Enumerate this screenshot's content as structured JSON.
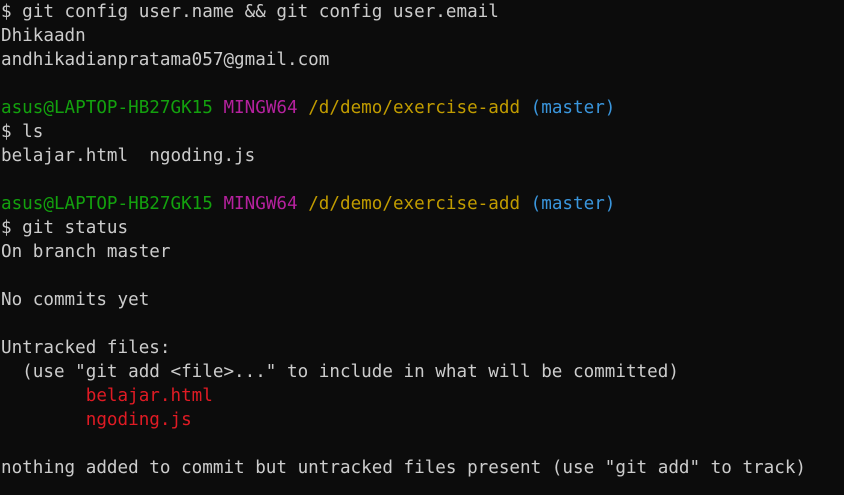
{
  "terminal": {
    "lines": [
      {
        "segments": [
          {
            "text": "$ git config user.name && git config user.email",
            "color": "white"
          }
        ]
      },
      {
        "segments": [
          {
            "text": "Dhikaadn",
            "color": "white"
          }
        ]
      },
      {
        "segments": [
          {
            "text": "andhikadianpratama057@gmail.com",
            "color": "white"
          }
        ]
      },
      {
        "segments": [
          {
            "text": "",
            "color": "white"
          }
        ]
      },
      {
        "segments": [
          {
            "text": "asus@LAPTOP-HB27GK15",
            "color": "green"
          },
          {
            "text": " ",
            "color": "white"
          },
          {
            "text": "MINGW64",
            "color": "magenta"
          },
          {
            "text": " ",
            "color": "white"
          },
          {
            "text": "/d/demo/exercise-add",
            "color": "yellow"
          },
          {
            "text": " ",
            "color": "white"
          },
          {
            "text": "(master)",
            "color": "blue"
          }
        ]
      },
      {
        "segments": [
          {
            "text": "$ ls",
            "color": "white"
          }
        ]
      },
      {
        "segments": [
          {
            "text": "belajar.html  ngoding.js",
            "color": "white"
          }
        ]
      },
      {
        "segments": [
          {
            "text": "",
            "color": "white"
          }
        ]
      },
      {
        "segments": [
          {
            "text": "asus@LAPTOP-HB27GK15",
            "color": "green"
          },
          {
            "text": " ",
            "color": "white"
          },
          {
            "text": "MINGW64",
            "color": "magenta"
          },
          {
            "text": " ",
            "color": "white"
          },
          {
            "text": "/d/demo/exercise-add",
            "color": "yellow"
          },
          {
            "text": " ",
            "color": "white"
          },
          {
            "text": "(master)",
            "color": "blue"
          }
        ]
      },
      {
        "segments": [
          {
            "text": "$ git status",
            "color": "white"
          }
        ]
      },
      {
        "segments": [
          {
            "text": "On branch master",
            "color": "white"
          }
        ]
      },
      {
        "segments": [
          {
            "text": "",
            "color": "white"
          }
        ]
      },
      {
        "segments": [
          {
            "text": "No commits yet",
            "color": "white"
          }
        ]
      },
      {
        "segments": [
          {
            "text": "",
            "color": "white"
          }
        ]
      },
      {
        "segments": [
          {
            "text": "Untracked files:",
            "color": "white"
          }
        ]
      },
      {
        "segments": [
          {
            "text": "  (use \"git add <file>...\" to include in what will be committed)",
            "color": "white"
          }
        ]
      },
      {
        "segments": [
          {
            "text": "        ",
            "color": "white"
          },
          {
            "text": "belajar.html",
            "color": "red"
          }
        ]
      },
      {
        "segments": [
          {
            "text": "        ",
            "color": "white"
          },
          {
            "text": "ngoding.js",
            "color": "red"
          }
        ]
      },
      {
        "segments": [
          {
            "text": "",
            "color": "white"
          }
        ]
      },
      {
        "segments": [
          {
            "text": "nothing added to commit but untracked files present (use \"git add\" to track)",
            "color": "white"
          }
        ]
      }
    ]
  },
  "colors": {
    "background": "#0c0c0c",
    "foreground": "#cccccc",
    "green": "#13a10e",
    "magenta": "#b5219e",
    "yellow": "#c19c00",
    "blue": "#3a96dd",
    "red": "#e01b24"
  }
}
